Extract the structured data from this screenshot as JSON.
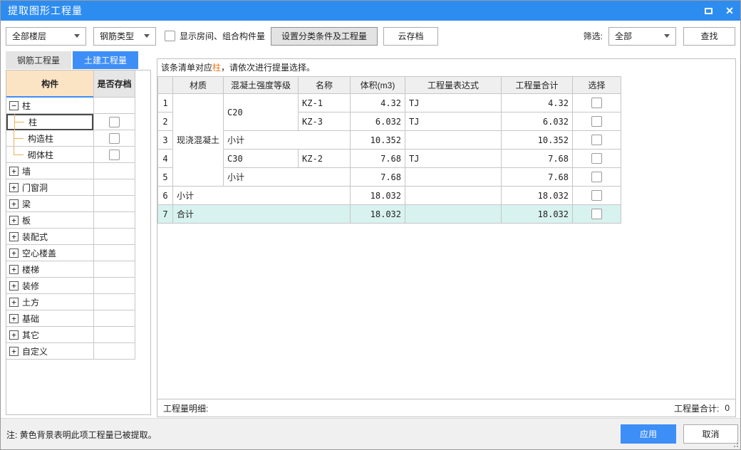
{
  "window": {
    "title": "提取图形工程量"
  },
  "toolbar": {
    "floor_select": "全部楼层",
    "rebar_type_select": "钢筋类型",
    "show_rooms_label": "显示房间、组合构件量",
    "setup_button": "设置分类条件及工程量",
    "cloud_button": "云存档",
    "filter_label": "筛选:",
    "filter_select": "全部",
    "find_button": "查找"
  },
  "tabs": [
    {
      "label": "钢筋工程量",
      "active": false
    },
    {
      "label": "土建工程量",
      "active": true
    }
  ],
  "tree": {
    "headers": {
      "component": "构件",
      "archived": "是否存档"
    },
    "items": [
      {
        "label": "柱",
        "level": 0,
        "expand": "minus",
        "checkbox": false
      },
      {
        "label": "柱",
        "level": 1,
        "checkbox": true,
        "selected": true
      },
      {
        "label": "构造柱",
        "level": 1,
        "checkbox": true
      },
      {
        "label": "砌体柱",
        "level": 1,
        "checkbox": true,
        "last": true
      },
      {
        "label": "墙",
        "level": 0,
        "expand": "plus"
      },
      {
        "label": "门窗洞",
        "level": 0,
        "expand": "plus"
      },
      {
        "label": "梁",
        "level": 0,
        "expand": "plus"
      },
      {
        "label": "板",
        "level": 0,
        "expand": "plus"
      },
      {
        "label": "装配式",
        "level": 0,
        "expand": "plus"
      },
      {
        "label": "空心楼盖",
        "level": 0,
        "expand": "plus"
      },
      {
        "label": "楼梯",
        "level": 0,
        "expand": "plus"
      },
      {
        "label": "装修",
        "level": 0,
        "expand": "plus"
      },
      {
        "label": "土方",
        "level": 0,
        "expand": "plus"
      },
      {
        "label": "基础",
        "level": 0,
        "expand": "plus"
      },
      {
        "label": "其它",
        "level": 0,
        "expand": "plus"
      },
      {
        "label": "自定义",
        "level": 0,
        "expand": "plus"
      }
    ]
  },
  "main": {
    "message_prefix": "该条清单对应",
    "message_highlight": "柱",
    "message_suffix": "，请依次进行提量选择。",
    "table": {
      "headers": [
        "",
        "材质",
        "混凝土强度等级",
        "名称",
        "体积(m3)",
        "工程量表达式",
        "工程量合计",
        "选择"
      ],
      "rows": [
        {
          "num": "1",
          "material": "现浇混凝土",
          "grade": "C20",
          "name": "KZ-1",
          "volume": "4.32",
          "expr": "TJ",
          "total": "4.32"
        },
        {
          "num": "2",
          "name": "KZ-3",
          "volume": "6.032",
          "expr": "TJ",
          "total": "6.032"
        },
        {
          "num": "3",
          "subtotal": "小计",
          "volume": "10.352",
          "expr": "",
          "total": "10.352"
        },
        {
          "num": "4",
          "grade": "C30",
          "name": "KZ-2",
          "volume": "7.68",
          "expr": "TJ",
          "total": "7.68"
        },
        {
          "num": "5",
          "subtotal": "小计",
          "volume": "7.68",
          "expr": "",
          "total": "7.68"
        },
        {
          "num": "6",
          "subtotal": "小计",
          "volume": "18.032",
          "expr": "",
          "total": "18.032"
        },
        {
          "num": "7",
          "subtotal": "合计",
          "volume": "18.032",
          "expr": "",
          "total": "18.032"
        }
      ]
    },
    "footbar_left": "工程量明细:",
    "footbar_right_label": "工程量合计:",
    "footbar_right_value": "0"
  },
  "footer": {
    "note": "注: 黄色背景表明此项工程量已被提取。",
    "apply_button": "应用",
    "cancel_button": "取消"
  },
  "colors": {
    "titlebar_blue": "#2d8cf0",
    "accent_blue": "#3e8ef7",
    "component_header_peach": "#fbe4c4",
    "tree_line_orange": "#e8b15e",
    "highlight_orange": "#e8791a",
    "total_row_cyan": "#d8f2ef",
    "footer_gray": "#f0f0f0"
  }
}
